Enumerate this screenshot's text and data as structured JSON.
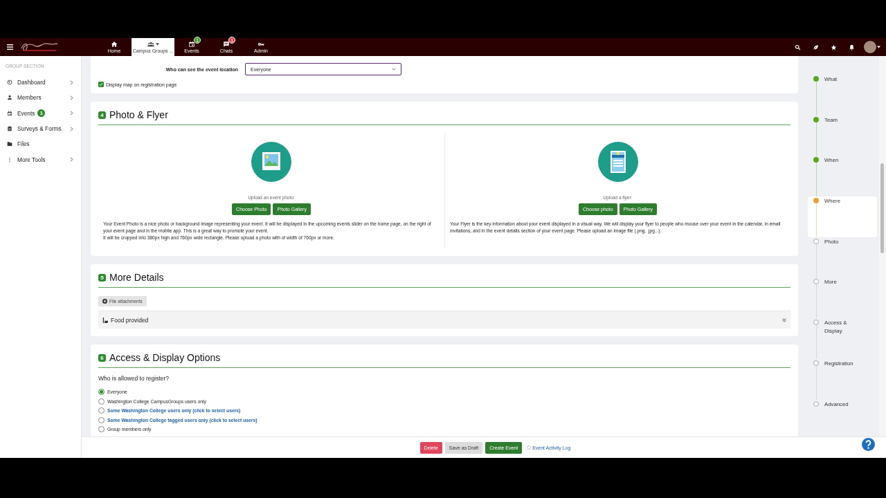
{
  "nav": {
    "items": [
      {
        "label": "Home",
        "selected": false
      },
      {
        "label": "Campus Groups ...",
        "selected": true,
        "caret": true
      },
      {
        "label": "Events",
        "selected": false,
        "badge": {
          "text": "1",
          "color": "#3a9b2e"
        }
      },
      {
        "label": "Chats",
        "selected": false,
        "badge": {
          "text": "1",
          "color": "#e0474c"
        }
      },
      {
        "label": "Admin",
        "selected": false
      }
    ]
  },
  "sidebar": {
    "section": "GROUP SECTION",
    "items": [
      {
        "label": "Dashboard",
        "chevron": true
      },
      {
        "label": "Members",
        "chevron": true
      },
      {
        "label": "Events",
        "chevron": true,
        "badge": "1"
      },
      {
        "label": "Surveys & Forms",
        "chevron": true
      },
      {
        "label": "Files",
        "chevron": false
      },
      {
        "label": "More Tools",
        "chevron": true
      }
    ]
  },
  "location_card": {
    "label": "Who can see the event location",
    "select_value": "Everyone",
    "checkbox": {
      "label": "Display map on registration page",
      "checked": true
    }
  },
  "photo_card": {
    "number": "4",
    "title": "Photo & Flyer",
    "columns": [
      {
        "kind": "photo",
        "label": "Upload an event photo:",
        "buttons": [
          "Choose Photo",
          "Photo Gallery"
        ],
        "paragraphs": [
          "Your Event Photo is a nice photo or background image representing your event. It will be displayed in the upcoming events slider on the home page, on the right of your event page and in the mobile app. This is a great way to promote your event.",
          "It will be cropped into 380px high and 760px wide rectangle. Please upload a photo with of width of 760px or more."
        ]
      },
      {
        "kind": "flyer",
        "label": "Upload a flyer:",
        "buttons": [
          "Choose photo",
          "Photo Gallery"
        ],
        "paragraphs": [
          "Your Flyer is the key information about your event displayed in a visual way. We will display your flyer to people who mouse over your event in the calendar, in email invitations, and in the event details section of your event page. Please upload an image file (.png, .jpg...)."
        ]
      }
    ]
  },
  "details_card": {
    "number": "5",
    "title": "More Details",
    "attach_button": "File attachments",
    "accordion": {
      "label": "Food provided",
      "expanded": false
    }
  },
  "access_card": {
    "number": "6",
    "title": "Access & Display Options",
    "question": "Who is allowed to register?",
    "options": [
      {
        "label": "Everyone",
        "kind": "plain",
        "selected": true
      },
      {
        "label": "Washington College CampusGroups users only",
        "kind": "plain",
        "selected": false
      },
      {
        "label": "Some Washington College users only (click to select users)",
        "kind": "link",
        "selected": false
      },
      {
        "label": "Some Washington College tagged users only (click to select users)",
        "kind": "link",
        "selected": false
      },
      {
        "label": "Group members only",
        "kind": "plain",
        "selected": false
      }
    ]
  },
  "steps": [
    {
      "label": "What",
      "completed": true,
      "selected": false
    },
    {
      "label": "Team",
      "completed": true,
      "selected": false
    },
    {
      "label": "When",
      "completed": true,
      "selected": false
    },
    {
      "label": "Where",
      "completed": false,
      "selected": true
    },
    {
      "label": "Photo",
      "completed": false,
      "selected": false
    },
    {
      "label": "More",
      "completed": false,
      "selected": false
    },
    {
      "label": "Access & Display",
      "completed": false,
      "selected": false
    },
    {
      "label": "Registration",
      "completed": false,
      "selected": false
    },
    {
      "label": "Advanced",
      "completed": false,
      "selected": false
    }
  ],
  "actions": [
    {
      "label": "Delete",
      "kind": "danger"
    },
    {
      "label": "Save as Draft",
      "kind": "secondary"
    },
    {
      "label": "Create Event",
      "kind": "primary"
    },
    {
      "label": "Event Activity Log",
      "kind": "link"
    }
  ]
}
